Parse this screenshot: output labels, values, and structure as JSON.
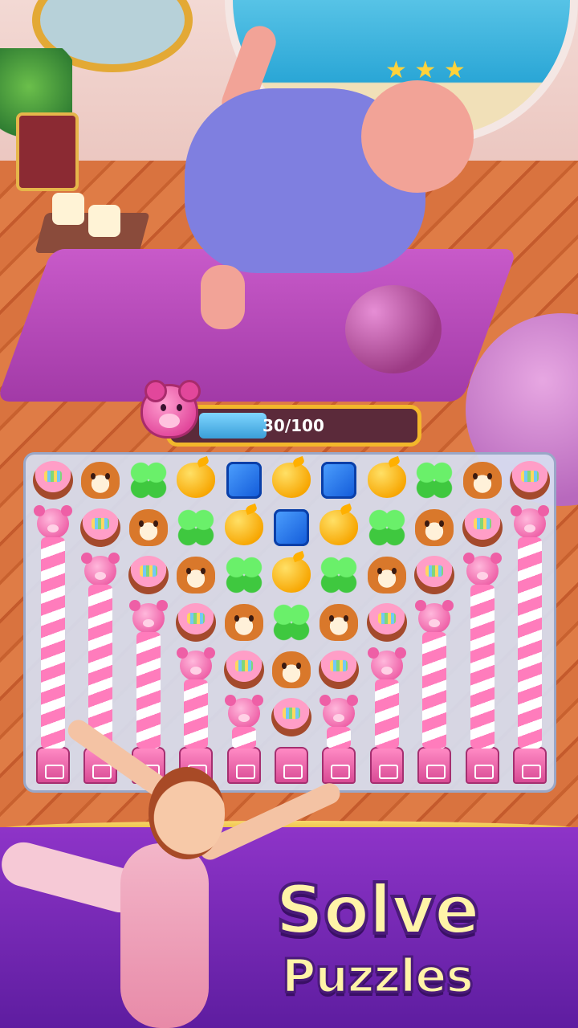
{
  "hud": {
    "progress_text": "30/100",
    "progress_value": 30,
    "progress_max": 100,
    "goal_icon": "pink-bear-candy-icon"
  },
  "board": {
    "columns": 11,
    "rows": 7,
    "top_rows": [
      [
        "pie",
        "squirrel",
        "clover",
        "apple",
        "cube",
        "apple",
        "cube",
        "apple",
        "clover",
        "squirrel",
        "pie"
      ],
      [
        "bear",
        "pie",
        "squirrel",
        "clover",
        "apple",
        "cube",
        "apple",
        "clover",
        "squirrel",
        "pie",
        "bear"
      ],
      [
        null,
        "bear",
        "pie",
        "squirrel",
        "clover",
        "apple",
        "clover",
        "squirrel",
        "pie",
        "bear",
        null
      ],
      [
        null,
        null,
        "bear",
        "pie",
        "squirrel",
        "clover",
        "squirrel",
        "pie",
        "bear",
        null,
        null
      ],
      [
        null,
        null,
        null,
        "bear",
        "pie",
        "squirrel",
        "pie",
        "bear",
        null,
        null,
        null
      ],
      [
        null,
        null,
        null,
        null,
        "bear",
        "pie",
        "bear",
        null,
        null,
        null,
        null
      ]
    ],
    "pillar_start_row": [
      1,
      2,
      3,
      4,
      5,
      null,
      5,
      4,
      3,
      2,
      1
    ]
  },
  "banner": {
    "title_line1": "Solve",
    "title_line2": "Puzzles"
  }
}
